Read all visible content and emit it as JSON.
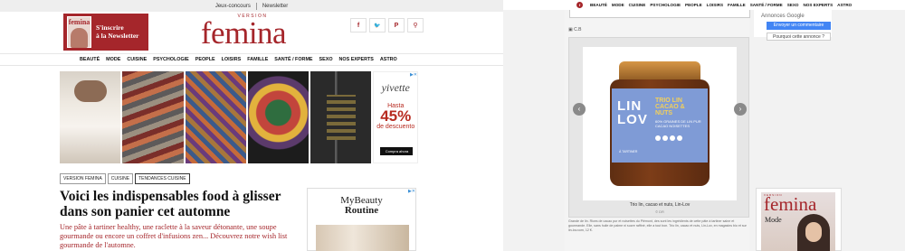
{
  "left": {
    "topbar": {
      "links": [
        "Jeux-concours",
        "Newsletter"
      ]
    },
    "newsletter_box": {
      "line1": "S'inscrire",
      "line2": "à la Newsletter",
      "magazine_name": "femina"
    },
    "logo": {
      "version": "VERSION",
      "name": "femina"
    },
    "social": [
      {
        "icon": "facebook-icon",
        "glyph": "f"
      },
      {
        "icon": "twitter-icon",
        "glyph": "🐦"
      },
      {
        "icon": "pinterest-icon",
        "glyph": "P"
      },
      {
        "icon": "search-icon",
        "glyph": "⚲"
      }
    ],
    "nav": [
      "BEAUTÉ",
      "MODE",
      "CUISINE",
      "PSYCHOLOGIE",
      "PEOPLE",
      "LOISIRS",
      "FAMILLE",
      "SANTÉ / FORME",
      "SEXO",
      "NOS EXPERTS",
      "ASTRO"
    ],
    "ad": {
      "brand": "yivette",
      "line1": "Hasta",
      "percent": "45%",
      "line2": "de descuento",
      "cta": "Compra ahora"
    },
    "breadcrumbs": [
      "VERSION FEMINA",
      "CUISINE",
      "TENDANCES CUISINE"
    ],
    "article": {
      "title": "Voici les indispensables food à glisser dans son panier cet automne",
      "subtitle": "Une pâte à tartiner healthy, une raclette à la saveur détonante, une soupe gourmande ou encore un coffret d'infusions zen... Découvrez notre wish list gourmande de l'automne."
    },
    "sidebar_ad": {
      "title1": "MyBeauty",
      "title2": "Routine"
    }
  },
  "right": {
    "nav": [
      "BEAUTÉ",
      "MODE",
      "CUISINE",
      "PSYCHOLOGIE",
      "PEOPLE",
      "LOISIRS",
      "FAMILLE",
      "SANTÉ / FORME",
      "SEXO",
      "NOS EXPERTS",
      "ASTRO"
    ],
    "credit": "C.B",
    "product": {
      "jar_line1": "LIN",
      "jar_line2": "LOV",
      "jar_title": "TRIO LIN CACAO & NUTS",
      "jar_desc": "60% GRAINES DE LIN PUR CACAO NOISETTES",
      "jar_footer": "À TARTINER",
      "caption": "Trio lin, cacao et nuts, Lin-Lov",
      "caption_credit": "© DR"
    },
    "description": "Grande de lin. Rices de cacao pur et noisettes du Piémont, des sont les ingrédients de cette pâte à tartiner saine et gourmande. Elle, sans huile de palme ni sucre raffiné, elle a tout bon. Trio lin, cacao et nuts, Lin-Lov, en magasins bio et sur lin-lov.com, 12 €.",
    "google_ad": {
      "label": "Annonces Google",
      "button1": "Envoyer un commentaire",
      "button2": "Pourquoi cette annonce ?"
    },
    "magazine": {
      "version": "VERSION",
      "name": "femina",
      "subtitle": "Mode"
    }
  }
}
